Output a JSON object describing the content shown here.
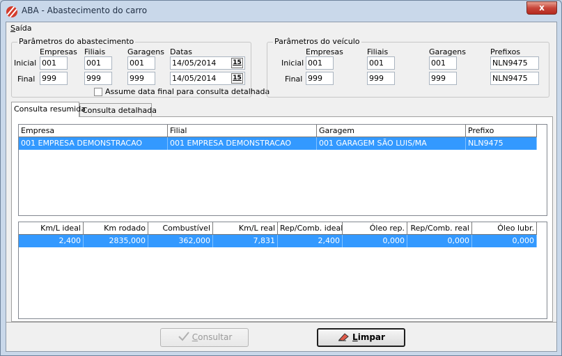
{
  "window": {
    "title": "ABA - Abastecimento do carro",
    "close_glyph": "x"
  },
  "menu": {
    "sair_first": "S",
    "sair_rest": "aída"
  },
  "abastecimento": {
    "legend": "Parâmetros do abastecimento",
    "col_empresas": "Empresas",
    "col_filiais": "Filiais",
    "col_garagens": "Garagens",
    "col_datas": "Datas",
    "row_inicial": "Inicial",
    "row_final": "Final",
    "inicial": {
      "empresa": "001",
      "filial": "001",
      "garagem": "001",
      "data": "14/05/2014"
    },
    "final": {
      "empresa": "999",
      "filial": "999",
      "garagem": "999",
      "data": "14/05/2014"
    },
    "date_btn": "15",
    "checkbox_label": "Assume data final para consulta detalhada",
    "checkbox_checked": false
  },
  "veiculo": {
    "legend": "Parâmetros do veículo",
    "col_empresas": "Empresas",
    "col_filiais": "Filiais",
    "col_garagens": "Garagens",
    "col_prefixos": "Prefixos",
    "row_inicial": "Inicial",
    "row_final": "Final",
    "inicial": {
      "empresa": "001",
      "filial": "001",
      "garagem": "001",
      "prefixo": "NLN9475"
    },
    "final": {
      "empresa": "999",
      "filial": "999",
      "garagem": "999",
      "prefixo": "NLN9475"
    }
  },
  "tabs": [
    {
      "label": "Consulta resumida",
      "active": true
    },
    {
      "label": "Consulta detalhada",
      "active": false
    }
  ],
  "grid1": {
    "headers": [
      "Empresa",
      "Filial",
      "Garagem",
      "Prefixo"
    ],
    "rows": [
      [
        "001 EMPRESA DEMONSTRACAO",
        "001 EMPRESA DEMONSTRACAO",
        "001 GARAGEM SÃO LUIS/MA",
        "NLN9475"
      ]
    ]
  },
  "grid2": {
    "headers": [
      "Km/L ideal",
      "Km rodado",
      "Combustível",
      "Km/L real",
      "Rep/Comb. ideal",
      "Óleo rep.",
      "Rep/Comb. real",
      "Óleo lubr."
    ],
    "rows": [
      [
        "2,400",
        "2835,000",
        "362,000",
        "7,831",
        "2,400",
        "0,000",
        "0,000",
        "0,000"
      ]
    ]
  },
  "buttons": {
    "consultar_first": "C",
    "consultar_rest": "onsultar",
    "consultar_enabled": false,
    "limpar_first": "L",
    "limpar_rest": "impar"
  },
  "colors": {
    "selection": "#3399ff",
    "title_bg": "#c9d8ea",
    "close_red": "#c7453a"
  },
  "icons": [
    "app-logo-icon",
    "close-icon",
    "calendar-icon",
    "check-icon",
    "eraser-icon"
  ]
}
